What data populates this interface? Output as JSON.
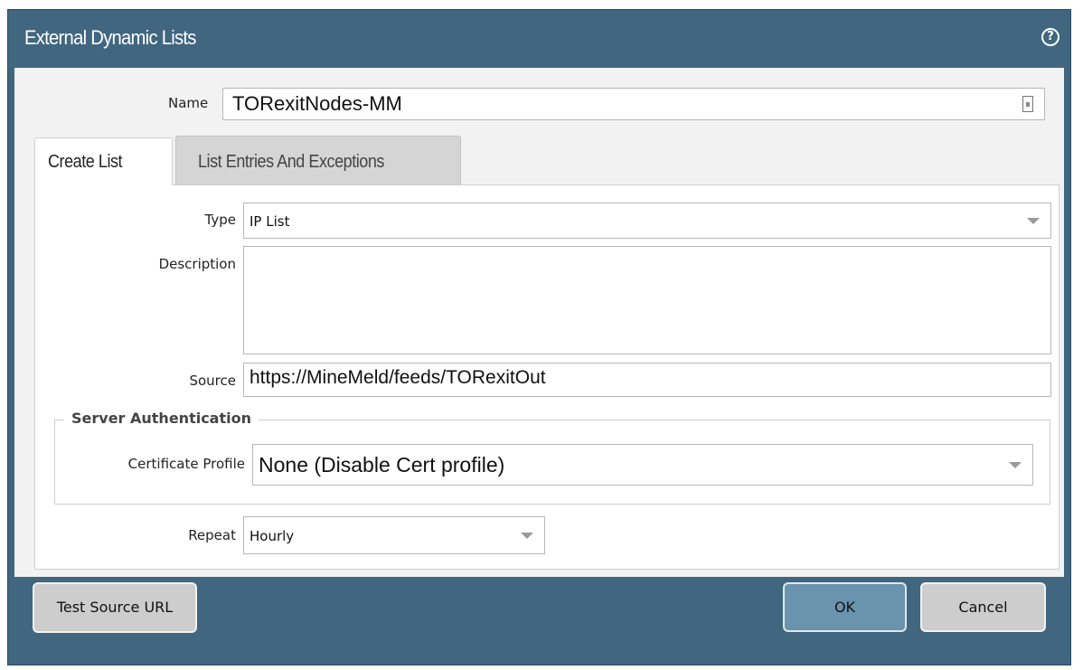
{
  "dialog": {
    "title": "External Dynamic Lists",
    "help_icon": "help-circle-icon"
  },
  "name_field": {
    "label": "Name",
    "value": "TORexitNodes-MM"
  },
  "tabs": [
    {
      "label": "Create List",
      "active": true
    },
    {
      "label": "List Entries And Exceptions",
      "active": false
    }
  ],
  "form": {
    "type": {
      "label": "Type",
      "value": "IP List"
    },
    "description": {
      "label": "Description",
      "value": ""
    },
    "source": {
      "label": "Source",
      "value": "https://MineMeld/feeds/TORexitOut"
    },
    "server_auth": {
      "legend": "Server Authentication",
      "certificate_profile": {
        "label": "Certificate Profile",
        "value": "None (Disable Cert profile)"
      }
    },
    "repeat": {
      "label": "Repeat",
      "value": "Hourly"
    }
  },
  "buttons": {
    "test_source": "Test Source URL",
    "ok": "OK",
    "cancel": "Cancel"
  },
  "colors": {
    "title_bar": "#416680",
    "ok_button": "#6a94ad",
    "content_bg": "#f2f2f2"
  }
}
